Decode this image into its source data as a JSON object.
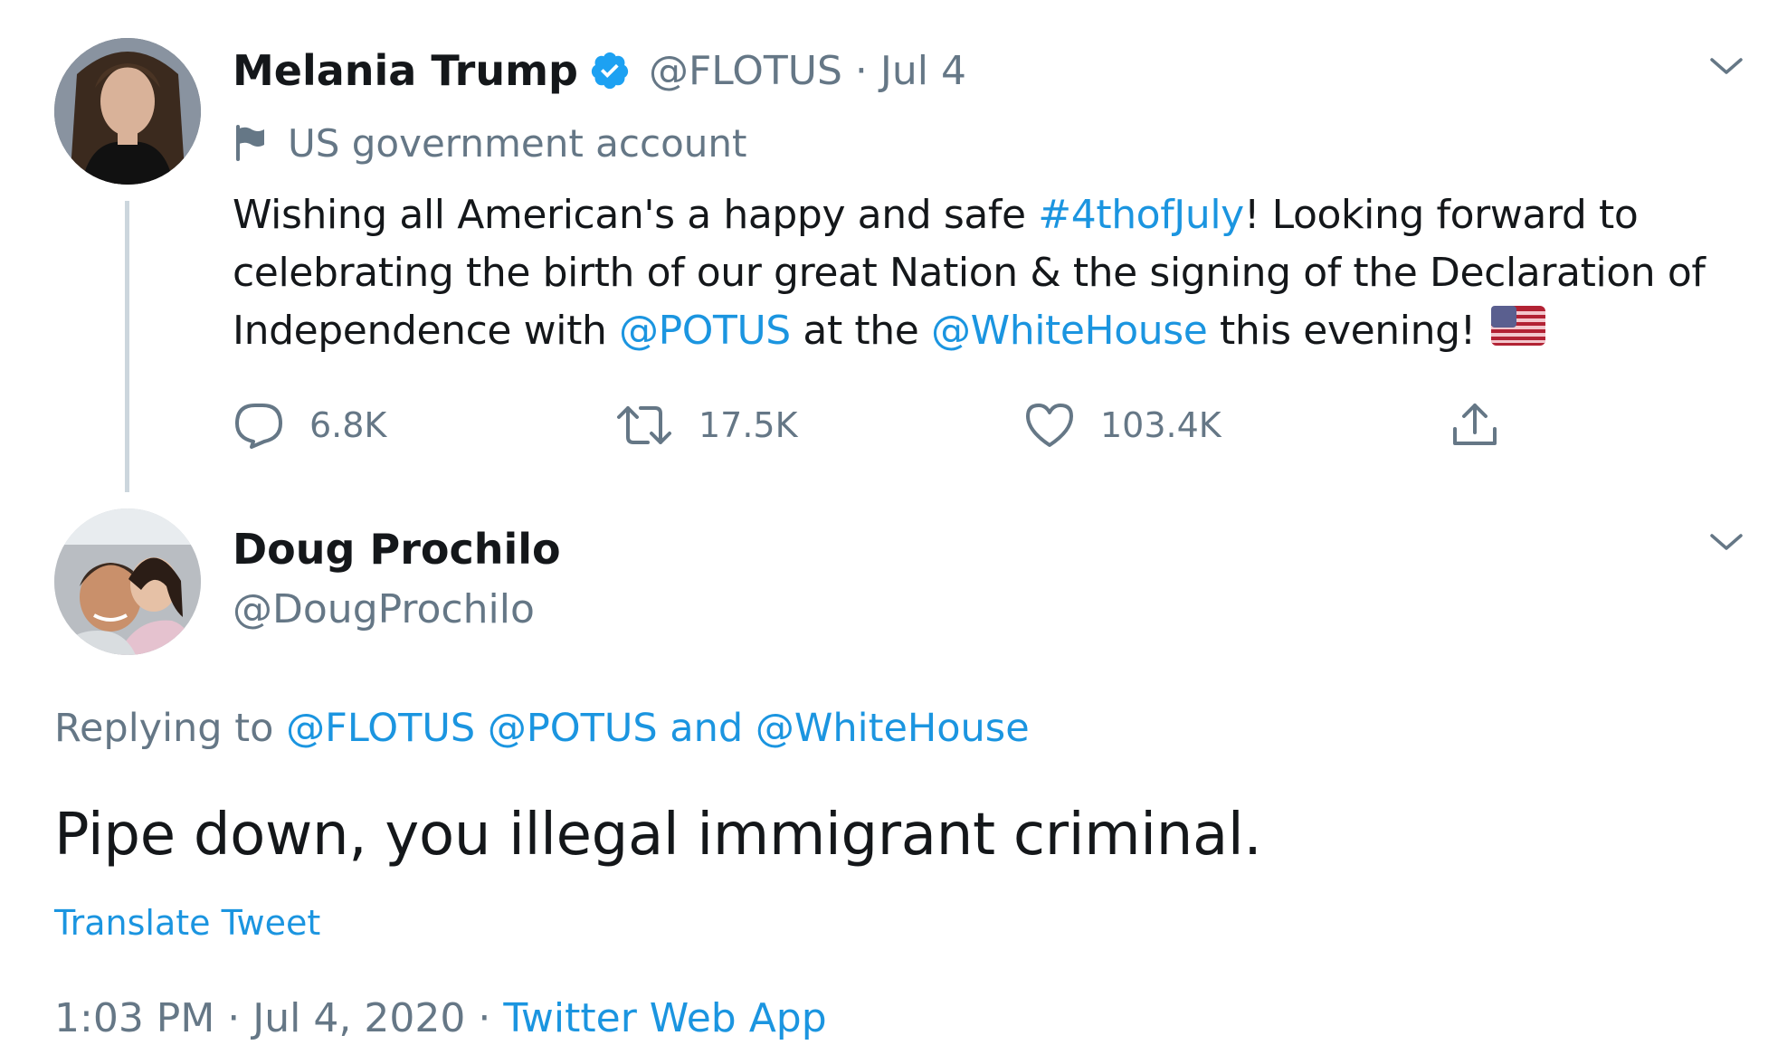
{
  "tweet": {
    "author_name": "Melania Trump",
    "handle": "@FLOTUS",
    "separator": "·",
    "date": "Jul 4",
    "account_label": "US government account",
    "text": {
      "l1_a": "Wishing all American's a happy and safe ",
      "l1_hashtag": "#4thofJuly",
      "l1_b": "! Looking forward to",
      "l2": "celebrating the birth of our great Nation & the signing of the Declaration of",
      "l3_a": "Independence with ",
      "l3_mention1": "@POTUS",
      "l3_b": " at the ",
      "l3_mention2": "@WhiteHouse",
      "l3_c": " this evening! "
    },
    "emoji": "flag-us-icon",
    "replies": "6.8K",
    "retweets": "17.5K",
    "likes": "103.4K"
  },
  "reply": {
    "author_name": "Doug Prochilo",
    "handle": "@DougProchilo",
    "replying_to_label": "Replying to ",
    "replying_to_1": "@FLOTUS",
    "replying_to_2": "@POTUS",
    "replying_to_and": "and",
    "replying_to_3": "@WhiteHouse",
    "text": "Pipe down, you illegal immigrant criminal.",
    "translate_label": "Translate Tweet",
    "time": "1:03 PM",
    "date": "Jul 4, 2020",
    "separator": "·",
    "source": "Twitter Web App"
  },
  "colors": {
    "link": "#1b95e0",
    "gray": "#657786",
    "verified": "#1da1f2",
    "text": "#14171a"
  },
  "icons": [
    "verified-badge-icon",
    "flag-icon",
    "reply-icon",
    "retweet-icon",
    "like-icon",
    "share-icon",
    "chevron-down-icon"
  ]
}
